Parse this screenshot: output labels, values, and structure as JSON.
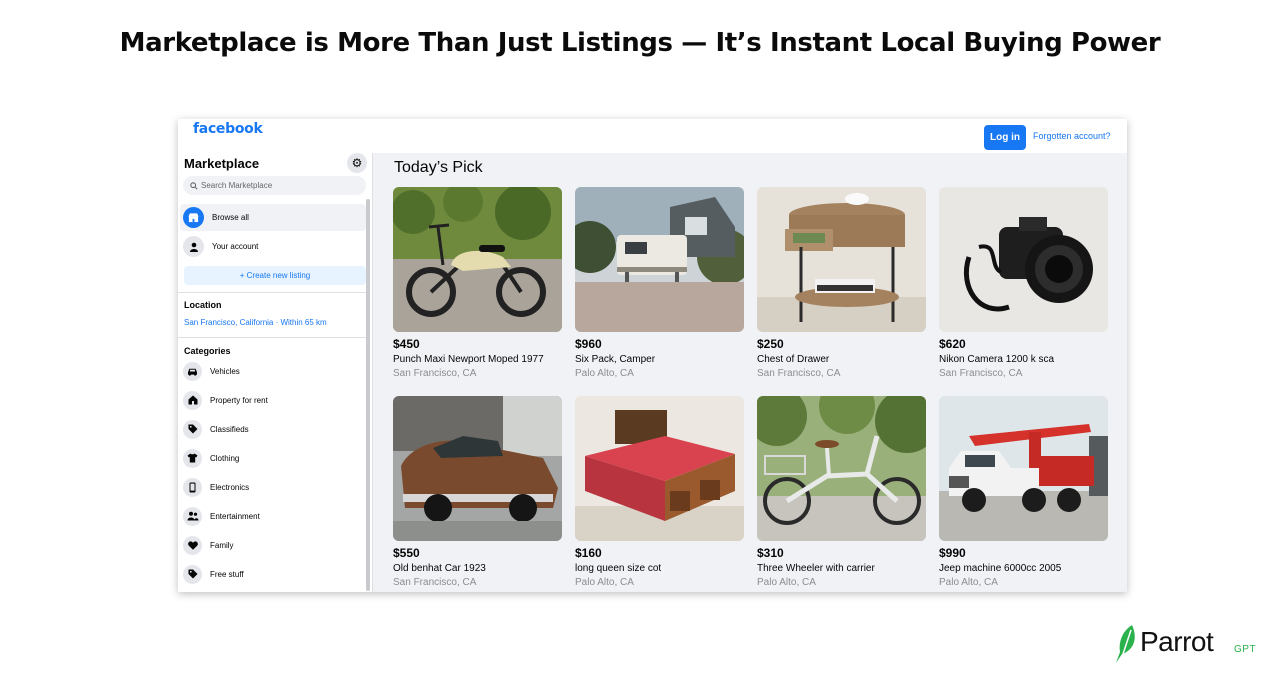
{
  "headline": "Marketplace is More Than Just Listings — It’s Instant Local Buying Power",
  "topbar": {
    "logo": "facebook",
    "login_label": "Log in",
    "forgot_label": "Forgotten account?"
  },
  "sidebar": {
    "title": "Marketplace",
    "settings_icon": "gear-icon",
    "search_placeholder": "Search Marketplace",
    "nav": [
      {
        "label": "Browse all",
        "icon": "storefront-icon"
      },
      {
        "label": "Your account",
        "icon": "person-icon"
      }
    ],
    "create_label": "+ Create new listing",
    "location_heading": "Location",
    "location_value": "San Francisco, California · Within 65 km",
    "categories_heading": "Categories",
    "categories": [
      {
        "label": "Vehicles",
        "icon": "car-icon"
      },
      {
        "label": "Property for rent",
        "icon": "house-icon"
      },
      {
        "label": "Classifieds",
        "icon": "tag-icon"
      },
      {
        "label": "Clothing",
        "icon": "shirt-icon"
      },
      {
        "label": "Electronics",
        "icon": "phone-icon"
      },
      {
        "label": "Entertainment",
        "icon": "people-icon"
      },
      {
        "label": "Family",
        "icon": "heart-icon"
      },
      {
        "label": "Free stuff",
        "icon": "tag-icon"
      }
    ]
  },
  "main": {
    "title": "Today’s Pick",
    "listings": [
      {
        "price": "$450",
        "title": "Punch Maxi Newport Moped 1977",
        "location": "San Francisco, CA",
        "image": "moped-photo"
      },
      {
        "price": "$960",
        "title": "Six Pack, Camper",
        "location": "Palo Alto, CA",
        "image": "camper-photo"
      },
      {
        "price": "$250",
        "title": "Chest of Drawer",
        "location": "San Francisco, CA",
        "image": "side-table-photo"
      },
      {
        "price": "$620",
        "title": "Nikon Camera 1200 k sca",
        "location": "San Francisco, CA",
        "image": "camera-photo"
      },
      {
        "price": "$550",
        "title": "Old benhat Car 1923",
        "location": "San Francisco, CA",
        "image": "vintage-car-photo"
      },
      {
        "price": "$160",
        "title": "long queen size cot",
        "location": "Palo Alto, CA",
        "image": "bed-photo"
      },
      {
        "price": "$310",
        "title": "Three Wheeler with carrier",
        "location": "Palo Alto, CA",
        "image": "tricycle-photo"
      },
      {
        "price": "$990",
        "title": "Jeep machine 6000cc 2005",
        "location": "Palo Alto, CA",
        "image": "crane-truck-photo"
      }
    ]
  },
  "brand": {
    "name": "Parrot",
    "suffix": "GPT",
    "accent": "#2bb24c"
  },
  "colors": {
    "facebook_blue": "#1877f2",
    "page_bg": "#f0f2f5"
  }
}
